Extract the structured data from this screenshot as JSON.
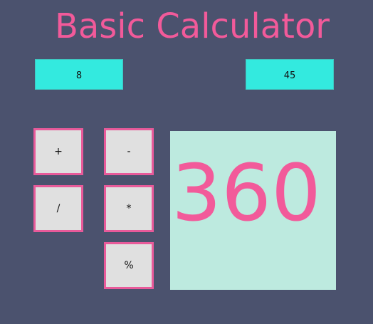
{
  "app": {
    "title": "Basic Calculator"
  },
  "inputs": {
    "first": "8",
    "second": "45"
  },
  "operations": {
    "add": "+",
    "subtract": "-",
    "divide": "/",
    "multiply": "*",
    "modulo": "%"
  },
  "result": {
    "value": "360"
  },
  "colors": {
    "background": "#4b526e",
    "accent": "#f25a9a",
    "input_background": "#33eadf",
    "result_background": "#bdeadf",
    "button_background": "#e0e0e0",
    "button_border": "#e85a9a"
  }
}
